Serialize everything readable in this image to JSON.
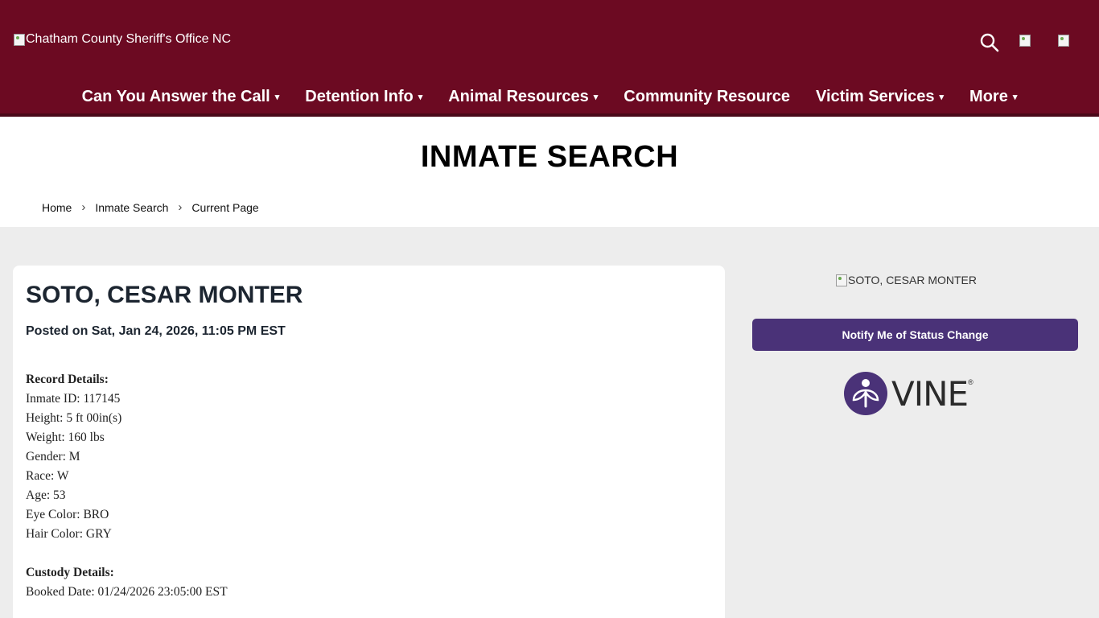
{
  "header": {
    "logo_alt": "Chatham County Sheriff's Office NC",
    "icons": [
      "search-icon",
      "social-icon",
      "social-icon"
    ],
    "colors": {
      "header_bg": "#6c0a22",
      "nav_text": "#ffffff"
    }
  },
  "nav": {
    "items": [
      {
        "label": "Can You Answer the Call",
        "has_dropdown": true
      },
      {
        "label": "Detention Info",
        "has_dropdown": true
      },
      {
        "label": "Animal Resources",
        "has_dropdown": true
      },
      {
        "label": "Community Resource",
        "has_dropdown": false
      },
      {
        "label": "Victim Services",
        "has_dropdown": true
      },
      {
        "label": "More",
        "has_dropdown": true
      }
    ],
    "caret": "▾"
  },
  "page": {
    "title": "INMATE SEARCH",
    "breadcrumb": [
      "Home",
      "Inmate Search",
      "Current Page"
    ],
    "breadcrumb_separator": "›"
  },
  "record": {
    "name": "SOTO, CESAR MONTER",
    "posted": "Posted on Sat, Jan 24, 2026, 11:05 PM EST",
    "record_heading": "Record Details:",
    "record_lines": [
      "Inmate ID: 117145",
      "Height: 5 ft 00in(s)",
      "Weight: 160 lbs",
      "Gender: M",
      "Race: W",
      "Age: 53",
      "Eye Color: BRO",
      "Hair Color: GRY"
    ],
    "custody_heading": "Custody Details:",
    "custody_lines": [
      "Booked Date: 01/24/2026 23:05:00 EST"
    ]
  },
  "sidebar": {
    "photo_alt": "SOTO, CESAR MONTER",
    "notify_label": "Notify Me of Status Change",
    "notify_color": "#4a3278",
    "vine_text": "VINE",
    "vine_registered": "®",
    "vine_color": "#4a3278"
  }
}
